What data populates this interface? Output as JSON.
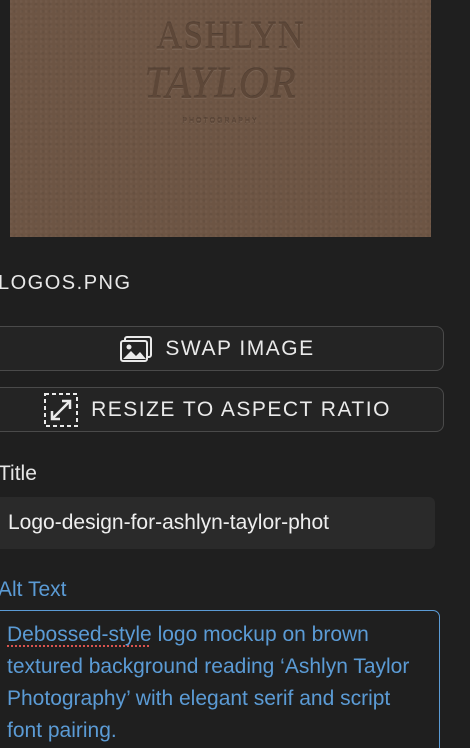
{
  "preview": {
    "logo_line1": "ASHLYN",
    "logo_line2": "TAYLOR",
    "logo_line3": "PHOTOGRAPHY",
    "background_color": "#6d5544"
  },
  "file": {
    "name": "LOGOS.PNG"
  },
  "buttons": {
    "swap_label": "SWAP IMAGE",
    "swap_icon": "image-icon",
    "resize_label": "RESIZE TO ASPECT RATIO",
    "resize_icon": "resize-expand-icon"
  },
  "title_field": {
    "label": "Title",
    "value": "Logo-design-for-ashlyn-taylor-phot"
  },
  "alt_text_field": {
    "label": "Alt Text",
    "misspelled_word": "Debossed-style",
    "value_rest": " logo mockup on brown textured background reading ‘Ashlyn Taylor Photography’ with elegant serif and script font pairing.",
    "accent_color": "#5b9bd5"
  }
}
